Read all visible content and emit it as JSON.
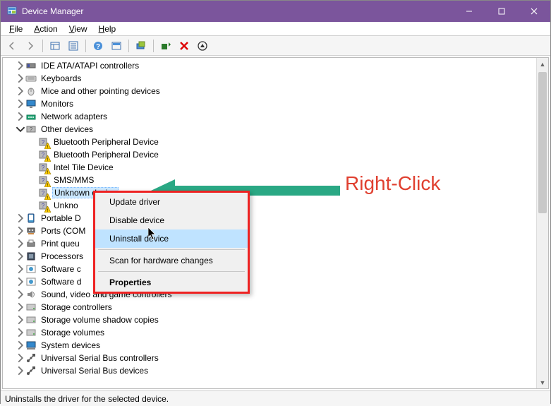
{
  "window": {
    "title": "Device Manager"
  },
  "menus": [
    "File",
    "Action",
    "View",
    "Help"
  ],
  "toolbar_icons": [
    "back-icon",
    "forward-icon",
    "sep",
    "show-hidden-icon",
    "properties-icon",
    "sep",
    "help-icon",
    "action-icon",
    "sep",
    "scan-hardware-icon",
    "sep",
    "update-driver-icon",
    "uninstall-icon",
    "details-icon"
  ],
  "tree": [
    {
      "level": 1,
      "expander": "right",
      "icon": "ide",
      "label": "IDE ATA/ATAPI controllers"
    },
    {
      "level": 1,
      "expander": "right",
      "icon": "keyboard",
      "label": "Keyboards"
    },
    {
      "level": 1,
      "expander": "right",
      "icon": "mouse",
      "label": "Mice and other pointing devices"
    },
    {
      "level": 1,
      "expander": "right",
      "icon": "monitor",
      "label": "Monitors"
    },
    {
      "level": 1,
      "expander": "right",
      "icon": "network",
      "label": "Network adapters"
    },
    {
      "level": 1,
      "expander": "down",
      "icon": "other",
      "label": "Other devices"
    },
    {
      "level": 2,
      "expander": "",
      "icon": "unknown-warn",
      "label": "Bluetooth Peripheral Device"
    },
    {
      "level": 2,
      "expander": "",
      "icon": "unknown-warn",
      "label": "Bluetooth Peripheral Device"
    },
    {
      "level": 2,
      "expander": "",
      "icon": "unknown-warn",
      "label": "Intel Tile Device"
    },
    {
      "level": 2,
      "expander": "",
      "icon": "unknown-warn",
      "label": "SMS/MMS"
    },
    {
      "level": 2,
      "expander": "",
      "icon": "unknown-warn",
      "label": "Unknown device",
      "selected": true
    },
    {
      "level": 2,
      "expander": "",
      "icon": "unknown-warn",
      "label": "Unknown device",
      "truncated": "Unkno"
    },
    {
      "level": 1,
      "expander": "right",
      "icon": "portable",
      "label": "Portable D",
      "truncated": "Portable D"
    },
    {
      "level": 1,
      "expander": "right",
      "icon": "ports",
      "label": "Ports (COM",
      "truncated": "Ports (COM"
    },
    {
      "level": 1,
      "expander": "right",
      "icon": "printer",
      "label": "Print queu",
      "truncated": "Print queu"
    },
    {
      "level": 1,
      "expander": "right",
      "icon": "cpu",
      "label": "Processors",
      "truncated": "Processors"
    },
    {
      "level": 1,
      "expander": "right",
      "icon": "software",
      "label": "Software c",
      "truncated": "Software c"
    },
    {
      "level": 1,
      "expander": "right",
      "icon": "software",
      "label": "Software d",
      "truncated": "Software d"
    },
    {
      "level": 1,
      "expander": "right",
      "icon": "sound",
      "label": "Sound, video and game controllers"
    },
    {
      "level": 1,
      "expander": "right",
      "icon": "storage",
      "label": "Storage controllers"
    },
    {
      "level": 1,
      "expander": "right",
      "icon": "storage",
      "label": "Storage volume shadow copies"
    },
    {
      "level": 1,
      "expander": "right",
      "icon": "storage",
      "label": "Storage volumes"
    },
    {
      "level": 1,
      "expander": "right",
      "icon": "system",
      "label": "System devices"
    },
    {
      "level": 1,
      "expander": "right",
      "icon": "usb",
      "label": "Universal Serial Bus controllers"
    },
    {
      "level": 1,
      "expander": "right",
      "icon": "usb",
      "label": "Universal Serial Bus devices"
    }
  ],
  "context_menu": {
    "items": [
      {
        "label": "Update driver",
        "hover": false
      },
      {
        "label": "Disable device",
        "hover": false
      },
      {
        "label": "Uninstall device",
        "hover": true
      },
      {
        "sep": true
      },
      {
        "label": "Scan for hardware changes",
        "hover": false
      },
      {
        "sep": true
      },
      {
        "label": "Properties",
        "hover": false,
        "bold": true
      }
    ]
  },
  "annotation": {
    "text": "Right-Click"
  },
  "statusbar": {
    "text": "Uninstalls the driver for the selected device."
  }
}
